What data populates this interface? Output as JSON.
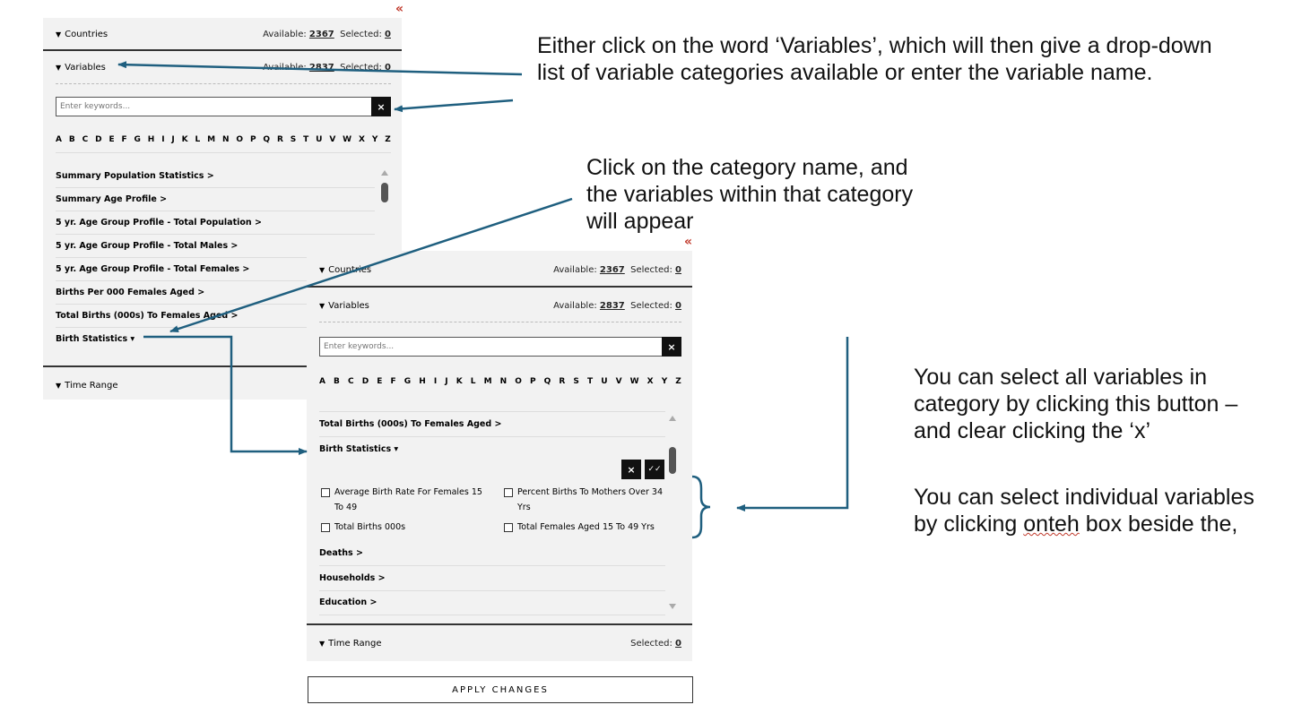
{
  "panel1": {
    "collapse": "«",
    "countries": {
      "label": "Countries",
      "available_label": "Available:",
      "available": "2367",
      "selected_label": "Selected:",
      "selected": "0"
    },
    "variables": {
      "label": "Variables",
      "available_label": "Available:",
      "available": "2837",
      "selected_label": "Selected:",
      "selected": "0"
    },
    "search_placeholder": "Enter keywords...",
    "clear": "×",
    "alphabet": [
      "A",
      "B",
      "C",
      "D",
      "E",
      "F",
      "G",
      "H",
      "I",
      "J",
      "K",
      "L",
      "M",
      "N",
      "O",
      "P",
      "Q",
      "R",
      "S",
      "T",
      "U",
      "V",
      "W",
      "X",
      "Y",
      "Z"
    ],
    "categories": [
      "Summary Population Statistics >",
      "Summary Age Profile >",
      "5 yr. Age Group Profile - Total Population >",
      "5 yr. Age Group Profile - Total Males >",
      "5 yr. Age Group Profile - Total Females >",
      "Births Per 000 Females Aged >",
      "Total Births (000s) To Females Aged >",
      "Birth Statistics ▾"
    ],
    "time_range": "Time Range"
  },
  "panel2": {
    "collapse": "«",
    "countries": {
      "label": "Countries",
      "available_label": "Available:",
      "available": "2367",
      "selected_label": "Selected:",
      "selected": "0"
    },
    "variables": {
      "label": "Variables",
      "available_label": "Available:",
      "available": "2837",
      "selected_label": "Selected:",
      "selected": "0"
    },
    "search_placeholder": "Enter keywords...",
    "clear": "×",
    "alphabet": [
      "A",
      "B",
      "C",
      "D",
      "E",
      "F",
      "G",
      "H",
      "I",
      "J",
      "K",
      "L",
      "M",
      "N",
      "O",
      "P",
      "Q",
      "R",
      "S",
      "T",
      "U",
      "V",
      "W",
      "X",
      "Y",
      "Z"
    ],
    "categories_top": [
      "Total Births (000s) To Females Aged >",
      "Birth Statistics ▾"
    ],
    "variables_list": [
      "Average Birth Rate For Females 15 To 49",
      "Percent Births To Mothers Over 34 Yrs",
      "Total Births 000s",
      "Total Females Aged 15 To 49 Yrs"
    ],
    "clear_all": "×",
    "select_all": "✓✓",
    "categories_bottom": [
      "Deaths >",
      "Households >",
      "Education >"
    ],
    "time_range": {
      "label": "Time Range",
      "selected_label": "Selected:",
      "selected": "0"
    }
  },
  "apply_label": "APPLY CHANGES",
  "notes": {
    "n1": "Either click on the word ‘Variables’, which will then give a drop-down list of variable categories available or enter the variable name.",
    "n2": "Click on the category name, and the variables within that category will appear",
    "n3": "You can select all variables in category by clicking this button – and clear clicking the ‘x’",
    "n4_a": "You can select individual variables by clicking ",
    "n4_b": "onteh",
    "n4_c": " box beside the,"
  },
  "colors": {
    "arrow": "#1f5f7f",
    "collapse": "#c0392b"
  }
}
